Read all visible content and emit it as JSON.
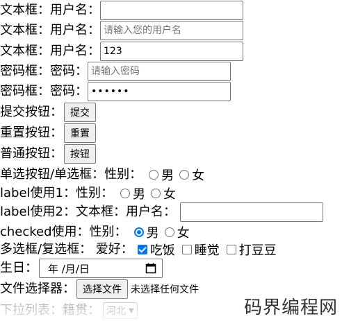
{
  "rows": {
    "text1": {
      "label": "文本框：用户名：",
      "value": ""
    },
    "text2": {
      "label": "文本框：用户名：",
      "placeholder": "请输入您的用户名"
    },
    "text3": {
      "label": "文本框：用户名：",
      "value": "123"
    },
    "pwd1": {
      "label": "密码框：密码：",
      "placeholder": "请输入密码"
    },
    "pwd2": {
      "label": "密码框：密码：",
      "value": "••••••"
    },
    "submit": {
      "label": "提交按钮：",
      "button": "提交"
    },
    "reset": {
      "label": "重置按钮：",
      "button": "重置"
    },
    "normal": {
      "label": "普通按钮：",
      "button": "按钮"
    },
    "radio1": {
      "label": "单选按钮/单选框：性别：",
      "opt1": "男",
      "opt2": "女"
    },
    "radio2": {
      "label": "label使用1：性别：",
      "opt1": "男",
      "opt2": "女"
    },
    "label2": {
      "label": "label使用2：文本框：用户名：",
      "value": ""
    },
    "checked": {
      "label": "checked使用：性别：",
      "opt1": "男",
      "opt2": "女",
      "selected": "男"
    },
    "checkbox": {
      "label": "多选框/复选框： 爱好：",
      "opt1": "吃饭",
      "opt2": "睡觉",
      "opt3": "打豆豆",
      "checked": [
        "吃饭"
      ]
    },
    "date": {
      "label": "生日：",
      "value": "年 /月/日"
    },
    "file": {
      "label": "文件选择器：",
      "button": "选择文件",
      "status": "未选择任何文件"
    },
    "select": {
      "label": "下拉列表：籍贯：",
      "value": "河北"
    }
  },
  "watermark": "码界编程网",
  "colors": {
    "accent": "#0075ff",
    "border": "#767676",
    "placeholder": "#757575"
  }
}
